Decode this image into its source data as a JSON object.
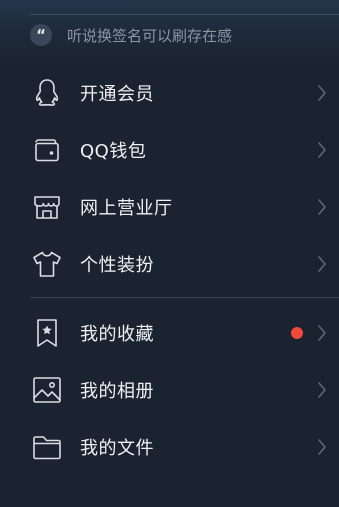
{
  "signature": {
    "quote_icon": "quote-icon",
    "text": "听说换签名可以刷存在感"
  },
  "menu_group_1": [
    {
      "label": "开通会员",
      "icon": "penguin-icon"
    },
    {
      "label": "QQ钱包",
      "icon": "wallet-icon"
    },
    {
      "label": "网上营业厅",
      "icon": "store-icon"
    },
    {
      "label": "个性装扮",
      "icon": "tshirt-icon"
    }
  ],
  "menu_group_2": [
    {
      "label": "我的收藏",
      "icon": "bookmark-star-icon",
      "has_badge": true
    },
    {
      "label": "我的相册",
      "icon": "image-icon"
    },
    {
      "label": "我的文件",
      "icon": "folder-icon"
    }
  ],
  "colors": {
    "background": "#1b2230",
    "badge_dot": "#ef4a3a",
    "icon_stroke": "#d9dee6",
    "chevron": "#5c6878"
  }
}
